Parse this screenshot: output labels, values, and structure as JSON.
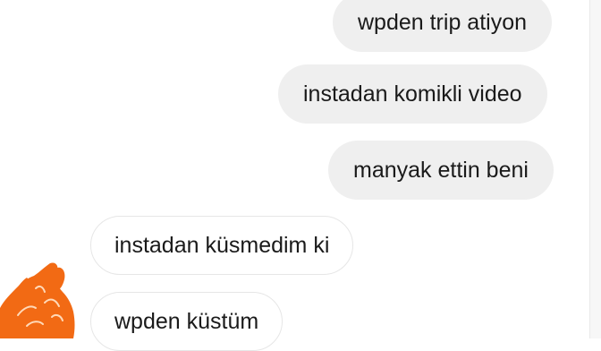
{
  "chat": {
    "messages": [
      {
        "text": "wpden trip atiyon",
        "side": "sent"
      },
      {
        "text": "instadan komikli video",
        "side": "sent"
      },
      {
        "text": "manyak ettin beni",
        "side": "sent"
      },
      {
        "text": "instadan küsmedim ki",
        "side": "received"
      },
      {
        "text": "wpden küstüm",
        "side": "received"
      }
    ]
  },
  "colors": {
    "sent_bubble": "#efefef",
    "received_bubble_border": "#e6e6e6",
    "scribble": "#f26a14"
  },
  "icons": {
    "avatar": "orange-scribble-avatar"
  }
}
